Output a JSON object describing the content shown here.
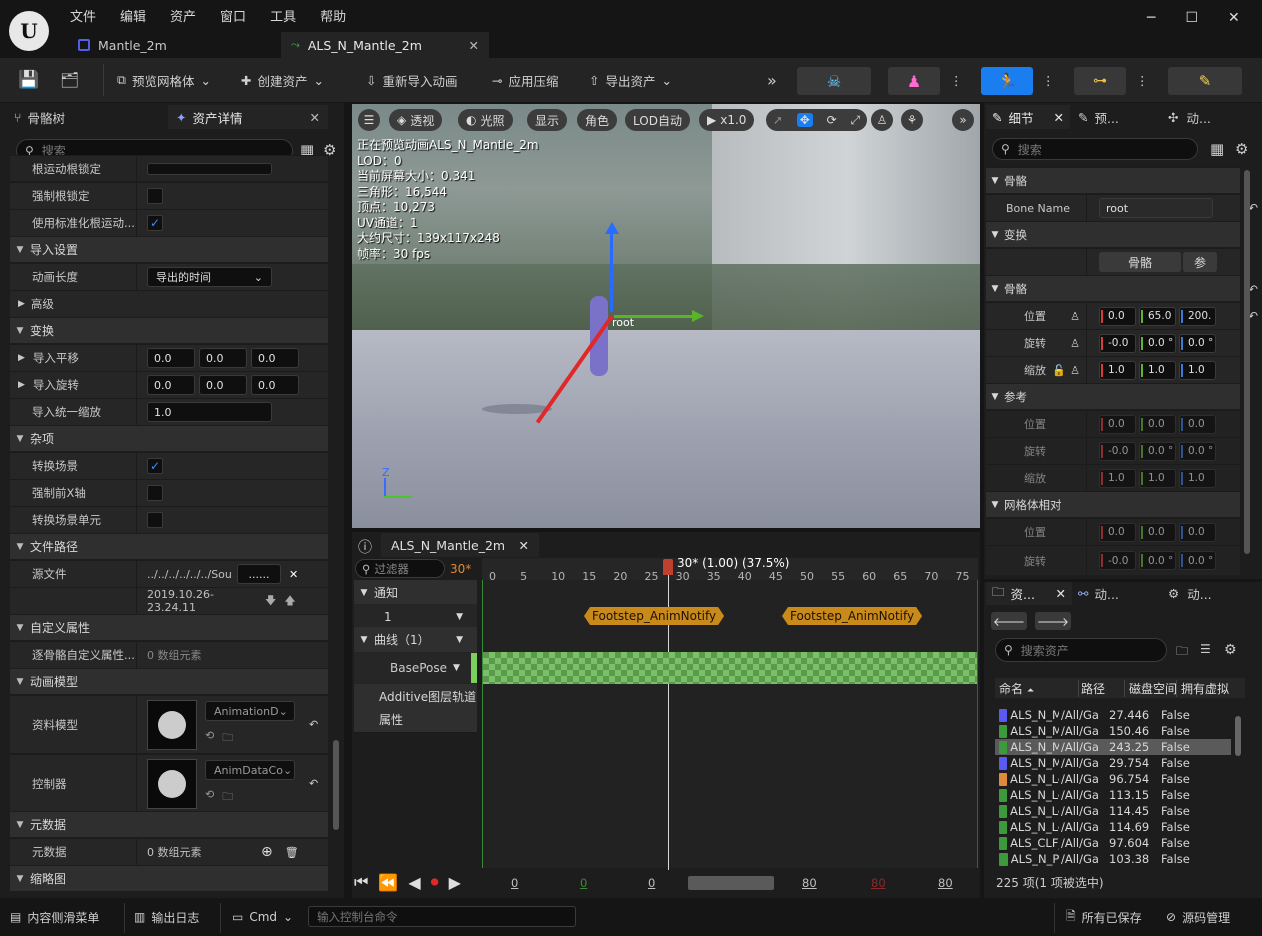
{
  "menu": [
    "文件",
    "编辑",
    "资产",
    "窗口",
    "工具",
    "帮助"
  ],
  "tabs": [
    {
      "label": "Mantle_2m"
    },
    {
      "label": "ALS_N_Mantle_2m"
    }
  ],
  "toolbar": {
    "preview_mesh": "预览网格体",
    "create_asset": "创建资产",
    "reimport": "重新导入动画",
    "apply_compression": "应用压缩",
    "export_asset": "导出资产"
  },
  "left": {
    "tab_skeleton": "骨骼树",
    "tab_details": "资产详情",
    "search_placeholder": "搜索",
    "rows": {
      "root_lock_partial": "根运动根锁定",
      "force_root_lock": "强制根锁定",
      "use_norm_root": "使用标准化根运动...",
      "import_settings": "导入设置",
      "anim_length": "动画长度",
      "anim_length_val": "导出的时间",
      "advanced": "高级",
      "transform": "变换",
      "import_translation": "导入平移",
      "import_rotation": "导入旋转",
      "import_uniform_scale": "导入统一缩放",
      "scale_val": "1.0",
      "zero": "0.0",
      "misc": "杂项",
      "convert_scene": "转换场景",
      "force_front_x": "强制前X轴",
      "convert_scene_unit": "转换场景单元",
      "file_path": "文件路径",
      "source_file": "源文件",
      "source_val": "../../../../../../Sou",
      "source_btn": "......",
      "timestamp": "2019.10.26-23.24.11",
      "custom_attrs": "自定义属性",
      "per_bone": "逐骨骼自定义属性...",
      "array_empty": "0 数组元素",
      "anim_model": "动画模型",
      "data_model": "资料模型",
      "data_model_val": "AnimationD",
      "controller": "控制器",
      "controller_val": "AnimDataCo",
      "metadata": "元数据",
      "metadata_row": "元数据",
      "metadata_val": "0 数组元素",
      "thumbnail": "缩略图"
    }
  },
  "viewport": {
    "perspective": "透视",
    "lit": "光照",
    "show": "显示",
    "character": "角色",
    "lod": "LOD自动",
    "speed": "x1.0",
    "stats": [
      "正在预览动画ALS_N_Mantle_2m",
      "LOD：0",
      "当前屏幕大小：0.341",
      "三角形：16,544",
      "顶点：10,273",
      "UV通道：1",
      "大约尺寸：139x117x248",
      "帧率：30 fps"
    ],
    "bone_label": "root",
    "axis_z": "Z"
  },
  "timeline": {
    "tab": "ALS_N_Mantle_2m",
    "filter_placeholder": "过滤器",
    "fps": "30*",
    "marker": "30* (1.00) (37.5%)",
    "ticks": [
      "0",
      "5",
      "10",
      "15",
      "20",
      "25",
      "30",
      "35",
      "40",
      "45",
      "50",
      "55",
      "60",
      "65",
      "70",
      "75"
    ],
    "notify": "通知",
    "notify_track": "1",
    "curves": "曲线（1）",
    "basepose": "BasePose",
    "additive": "Additive图层轨道",
    "attributes": "属性",
    "events": [
      "Footstep_AnimNotify",
      "Footstep_AnimNotify"
    ],
    "frames": [
      "0",
      "0",
      "0",
      "80",
      "80",
      "80"
    ]
  },
  "details": {
    "tab": "细节",
    "tab2": "预...",
    "tab3": "动...",
    "search_placeholder": "搜索",
    "bone": "骨骼",
    "bone_name_lbl": "Bone Name",
    "bone_name": "root",
    "transform": "变换",
    "bone_btn": "骨骼",
    "bone_btn2": "参",
    "bone_sec": "骨骼",
    "location": "位置",
    "rotation": "旋转",
    "scale": "缩放",
    "loc": [
      "0.0",
      "65.0",
      "200."
    ],
    "rot": [
      "-0.0",
      "0.0 °",
      "0.0 °"
    ],
    "scl": [
      "1.0",
      "1.0",
      "1.0"
    ],
    "reference": "参考",
    "ref_loc": [
      "0.0",
      "0.0",
      "0.0"
    ],
    "ref_rot": [
      "-0.0",
      "0.0 °",
      "0.0 °"
    ],
    "ref_scl": [
      "1.0",
      "1.0",
      "1.0"
    ],
    "mesh_rel": "网格体相对",
    "mr_loc": [
      "0.0",
      "0.0",
      "0.0"
    ],
    "mr_rot": [
      "-0.0",
      "0.0 °",
      "0.0 °"
    ]
  },
  "browser": {
    "tab1": "资...",
    "tab2": "动...",
    "tab3": "动...",
    "search_placeholder": "搜索资产",
    "cols": [
      "命名",
      "路径",
      "磁盘空间",
      "拥有虚拟"
    ],
    "rows": [
      {
        "name": "ALS_N_Ma",
        "path": "/All/Ga",
        "size": "27.446",
        "virt": "False",
        "color": "#5a5af0"
      },
      {
        "name": "ALS_N_Ma",
        "path": "/All/Ga",
        "size": "150.46",
        "virt": "False",
        "color": "#3c9a3c"
      },
      {
        "name": "ALS_N_Ma",
        "path": "/All/Ga",
        "size": "243.25",
        "virt": "False",
        "color": "#3c9a3c"
      },
      {
        "name": "ALS_N_Ma",
        "path": "/All/Ga",
        "size": "29.754",
        "virt": "False",
        "color": "#5a5af0"
      },
      {
        "name": "ALS_N_Loc",
        "path": "/All/Ga",
        "size": "96.754",
        "virt": "False",
        "color": "#e08a3c"
      },
      {
        "name": "ALS_N_Loc",
        "path": "/All/Ga",
        "size": "113.15",
        "virt": "False",
        "color": "#3c9a3c"
      },
      {
        "name": "ALS_N_Loc",
        "path": "/All/Ga",
        "size": "114.45",
        "virt": "False",
        "color": "#3c9a3c"
      },
      {
        "name": "ALS_N_Loc",
        "path": "/All/Ga",
        "size": "114.69",
        "virt": "False",
        "color": "#3c9a3c"
      },
      {
        "name": "ALS_CLF_F",
        "path": "/All/Ga",
        "size": "97.604",
        "virt": "False",
        "color": "#3c9a3c"
      },
      {
        "name": "ALS_N_Po",
        "path": "/All/Ga",
        "size": "103.38",
        "virt": "False",
        "color": "#3c9a3c"
      }
    ],
    "count": "225 项(1 项被选中)"
  },
  "status": {
    "content_drawer": "内容侧滑菜单",
    "output_log": "输出日志",
    "cmd": "Cmd",
    "console_placeholder": "输入控制台命令",
    "all_saved": "所有已保存",
    "source_control": "源码管理"
  }
}
